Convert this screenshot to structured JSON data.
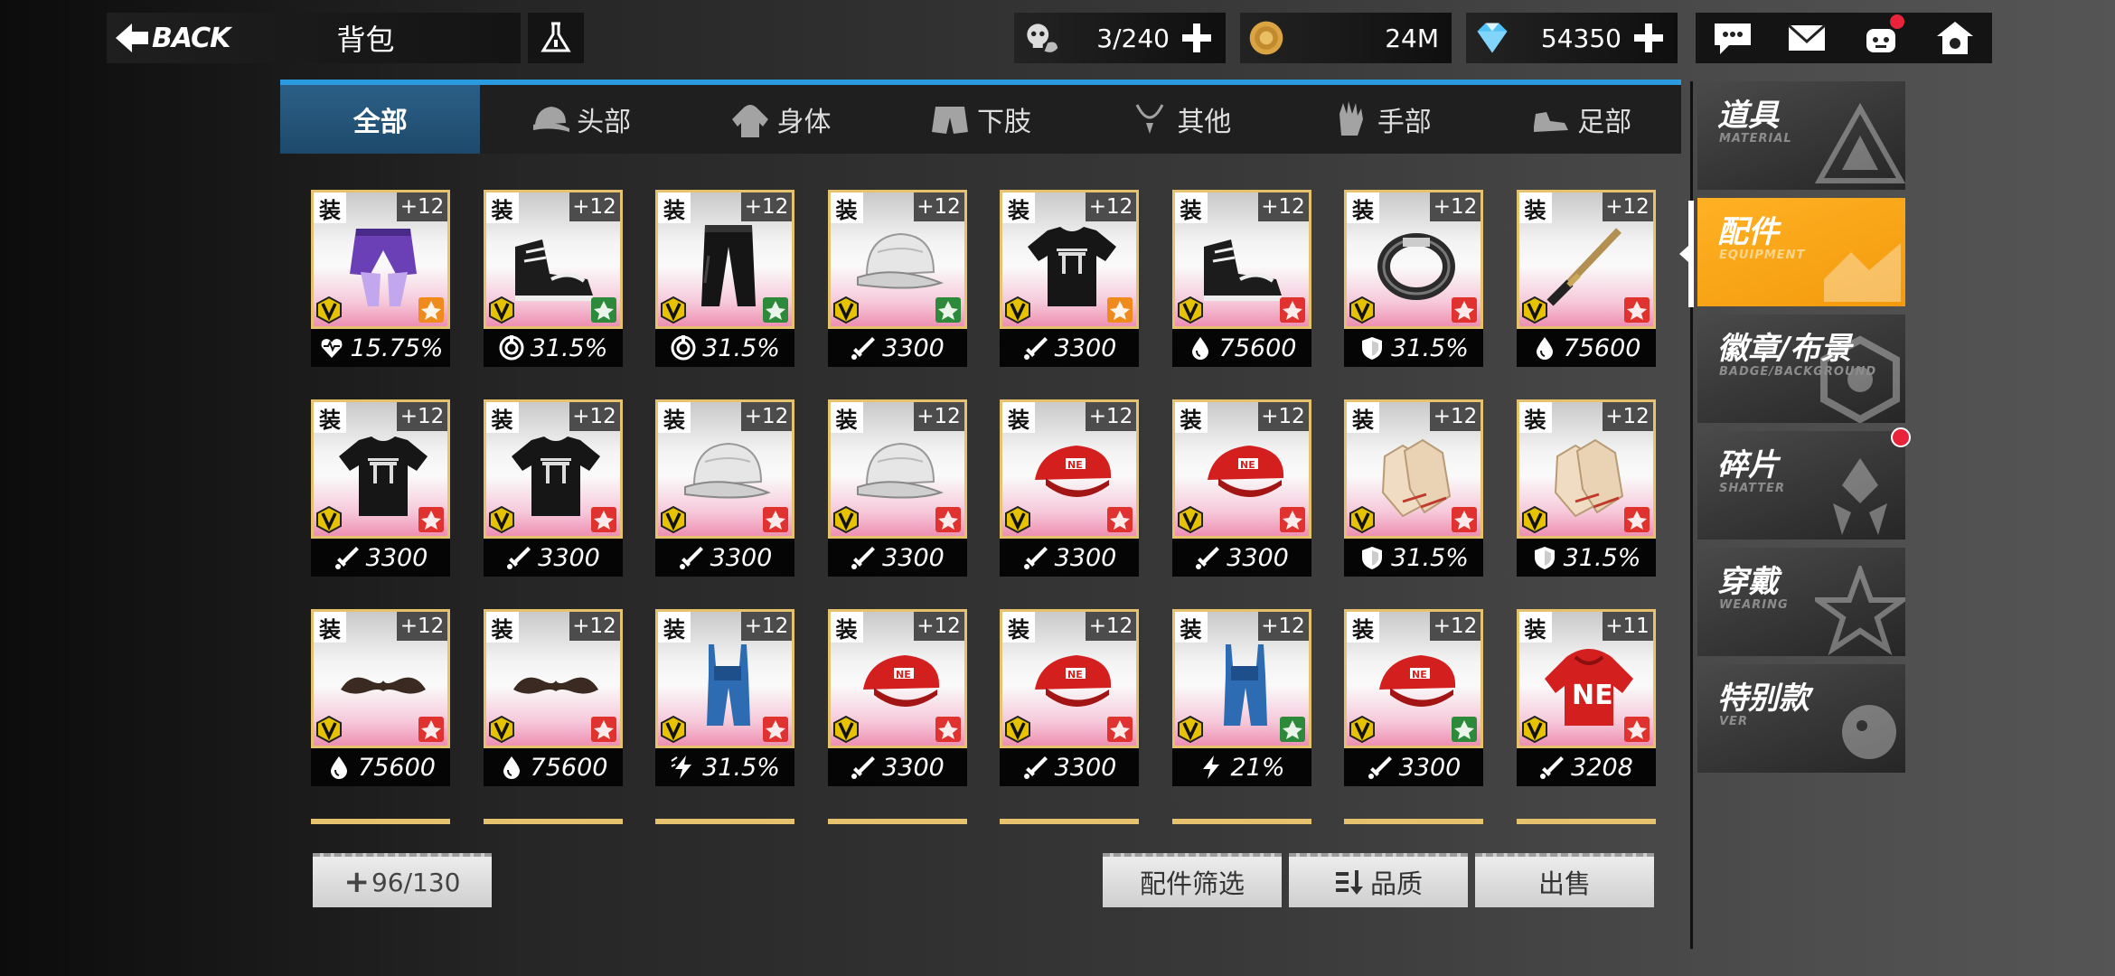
{
  "header": {
    "back_label": "BACK",
    "title": "背包",
    "resources": [
      {
        "name": "skull-currency",
        "value": "3/240",
        "has_plus": true,
        "icon": "skull-hand-icon"
      },
      {
        "name": "gold-coin",
        "value": "24M",
        "has_plus": false,
        "icon": "coin-icon"
      },
      {
        "name": "diamond",
        "value": "54350",
        "has_plus": true,
        "icon": "diamond-icon"
      }
    ],
    "icons": [
      "chat-icon",
      "mail-icon",
      "gift-bot-icon",
      "settings-home-icon"
    ]
  },
  "tabs": [
    {
      "label": "全部",
      "icon": "",
      "active": true
    },
    {
      "label": "头部",
      "icon": "cap-icon",
      "active": false
    },
    {
      "label": "身体",
      "icon": "hoodie-icon",
      "active": false
    },
    {
      "label": "下肢",
      "icon": "shorts-icon",
      "active": false
    },
    {
      "label": "其他",
      "icon": "necklace-icon",
      "active": false
    },
    {
      "label": "手部",
      "icon": "glove-icon",
      "active": false
    },
    {
      "label": "足部",
      "icon": "sneaker-icon",
      "active": false
    }
  ],
  "items": [
    {
      "equip": "装",
      "level": "+12",
      "art": "purple-shorts",
      "attr": "orange",
      "stat_icon": "heart",
      "stat": "15.75%"
    },
    {
      "equip": "装",
      "level": "+12",
      "art": "black-sneakers",
      "attr": "green",
      "stat_icon": "target",
      "stat": "31.5%"
    },
    {
      "equip": "装",
      "level": "+12",
      "art": "black-pants",
      "attr": "green",
      "stat_icon": "target",
      "stat": "31.5%"
    },
    {
      "equip": "装",
      "level": "+12",
      "art": "white-cap",
      "attr": "green",
      "stat_icon": "sword",
      "stat": "3300"
    },
    {
      "equip": "装",
      "level": "+12",
      "art": "black-tshirt",
      "attr": "orange",
      "stat_icon": "sword",
      "stat": "3300"
    },
    {
      "equip": "装",
      "level": "+12",
      "art": "black-sneakers",
      "attr": "red",
      "stat_icon": "drop",
      "stat": "75600"
    },
    {
      "equip": "装",
      "level": "+12",
      "art": "ring",
      "attr": "red",
      "stat_icon": "shield",
      "stat": "31.5%"
    },
    {
      "equip": "装",
      "level": "+12",
      "art": "katana",
      "attr": "red",
      "stat_icon": "drop",
      "stat": "75600"
    },
    {
      "equip": "装",
      "level": "+12",
      "art": "black-tshirt",
      "attr": "red",
      "stat_icon": "sword",
      "stat": "3300"
    },
    {
      "equip": "装",
      "level": "+12",
      "art": "black-tshirt",
      "attr": "red",
      "stat_icon": "sword",
      "stat": "3300"
    },
    {
      "equip": "装",
      "level": "+12",
      "art": "white-cap",
      "attr": "red",
      "stat_icon": "sword",
      "stat": "3300"
    },
    {
      "equip": "装",
      "level": "+12",
      "art": "white-cap",
      "attr": "red",
      "stat_icon": "sword",
      "stat": "3300"
    },
    {
      "equip": "装",
      "level": "+12",
      "art": "red-cap",
      "attr": "red",
      "stat_icon": "sword",
      "stat": "3300"
    },
    {
      "equip": "装",
      "level": "+12",
      "art": "red-cap",
      "attr": "red",
      "stat_icon": "sword",
      "stat": "3300"
    },
    {
      "equip": "装",
      "level": "+12",
      "art": "gloves",
      "attr": "red",
      "stat_icon": "shield",
      "stat": "31.5%"
    },
    {
      "equip": "装",
      "level": "+12",
      "art": "gloves",
      "attr": "red",
      "stat_icon": "shield",
      "stat": "31.5%"
    },
    {
      "equip": "装",
      "level": "+12",
      "art": "mustache",
      "attr": "red",
      "stat_icon": "drop",
      "stat": "75600"
    },
    {
      "equip": "装",
      "level": "+12",
      "art": "mustache",
      "attr": "red",
      "stat_icon": "drop",
      "stat": "75600"
    },
    {
      "equip": "装",
      "level": "+12",
      "art": "blue-overalls",
      "attr": "red",
      "stat_icon": "crit",
      "stat": "31.5%"
    },
    {
      "equip": "装",
      "level": "+12",
      "art": "red-cap",
      "attr": "red",
      "stat_icon": "sword",
      "stat": "3300"
    },
    {
      "equip": "装",
      "level": "+12",
      "art": "red-cap",
      "attr": "red",
      "stat_icon": "sword",
      "stat": "3300"
    },
    {
      "equip": "装",
      "level": "+12",
      "art": "blue-overalls",
      "attr": "green",
      "stat_icon": "bolt",
      "stat": "21%"
    },
    {
      "equip": "装",
      "level": "+12",
      "art": "red-cap",
      "attr": "green",
      "stat_icon": "sword",
      "stat": "3300"
    },
    {
      "equip": "装",
      "level": "+11",
      "art": "red-hoodie",
      "attr": "red",
      "stat_icon": "sword",
      "stat": "3208"
    }
  ],
  "bottom": {
    "capacity": "96/130",
    "capacity_plus": "+",
    "filter_label": "配件筛选",
    "quality_label": "品质",
    "sell_label": "出售"
  },
  "sidebar": [
    {
      "title": "道具",
      "subtitle": "MATERIAL",
      "active": false,
      "dot": false
    },
    {
      "title": "配件",
      "subtitle": "EQUIPMENT",
      "active": true,
      "dot": false
    },
    {
      "title": "徽章/布景",
      "subtitle": "BADGE/BACKGROUND",
      "active": false,
      "dot": false
    },
    {
      "title": "碎片",
      "subtitle": "SHATTER",
      "active": false,
      "dot": true
    },
    {
      "title": "穿戴",
      "subtitle": "WEARING",
      "active": false,
      "dot": false
    },
    {
      "title": "特别款",
      "subtitle": "VER",
      "active": false,
      "dot": false
    }
  ],
  "colors": {
    "tab_accent": "#2a9be0",
    "sidebar_active": "#f5a214",
    "card_border": "#e6c16e",
    "attr_red": "#e0322f",
    "attr_green": "#2c8a3a",
    "attr_orange": "#f08a1c"
  }
}
